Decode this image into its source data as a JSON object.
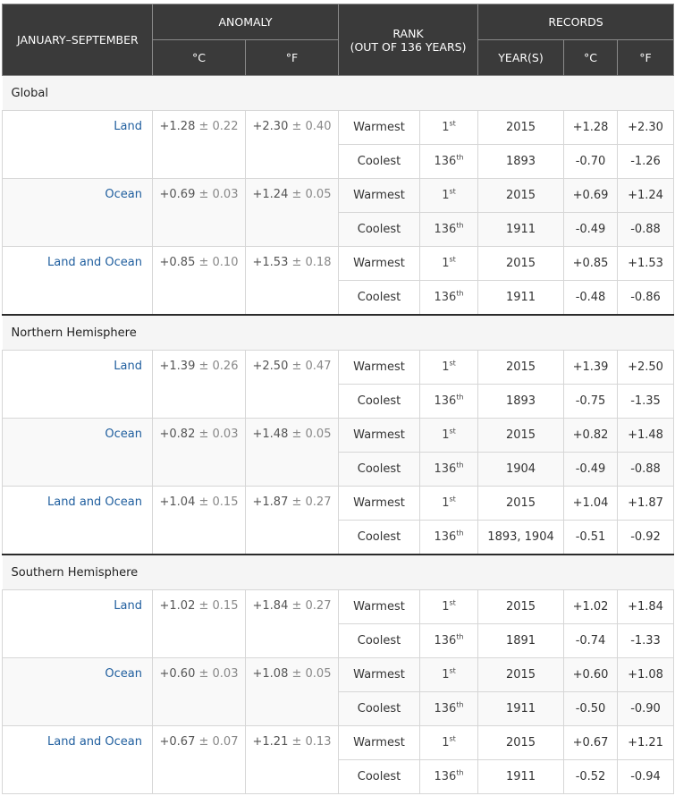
{
  "header": {
    "period": "JANUARY–SEPTEMBER",
    "anomaly": "ANOMALY",
    "rank_title": "RANK",
    "rank_sub": "(OUT OF 136 YEARS)",
    "records": "RECORDS",
    "unit_c": "°C",
    "unit_f": "°F",
    "years": "YEAR(S)"
  },
  "pm": "±",
  "labels": {
    "warmest": "Warmest",
    "coolest": "Coolest"
  },
  "regions": [
    {
      "name": "Global",
      "rows": [
        {
          "name": "Land",
          "anom_c": "+1.28",
          "unc_c": "0.22",
          "anom_f": "+2.30",
          "unc_f": "0.40",
          "warm": {
            "rank": "1",
            "suffix": "st",
            "year": "2015",
            "c": "+1.28",
            "f": "+2.30"
          },
          "cool": {
            "rank": "136",
            "suffix": "th",
            "year": "1893",
            "c": "-0.70",
            "f": "-1.26"
          }
        },
        {
          "name": "Ocean",
          "anom_c": "+0.69",
          "unc_c": "0.03",
          "anom_f": "+1.24",
          "unc_f": "0.05",
          "warm": {
            "rank": "1",
            "suffix": "st",
            "year": "2015",
            "c": "+0.69",
            "f": "+1.24"
          },
          "cool": {
            "rank": "136",
            "suffix": "th",
            "year": "1911",
            "c": "-0.49",
            "f": "-0.88"
          }
        },
        {
          "name": "Land and Ocean",
          "anom_c": "+0.85",
          "unc_c": "0.10",
          "anom_f": "+1.53",
          "unc_f": "0.18",
          "warm": {
            "rank": "1",
            "suffix": "st",
            "year": "2015",
            "c": "+0.85",
            "f": "+1.53"
          },
          "cool": {
            "rank": "136",
            "suffix": "th",
            "year": "1911",
            "c": "-0.48",
            "f": "-0.86"
          }
        }
      ]
    },
    {
      "name": "Northern Hemisphere",
      "rows": [
        {
          "name": "Land",
          "anom_c": "+1.39",
          "unc_c": "0.26",
          "anom_f": "+2.50",
          "unc_f": "0.47",
          "warm": {
            "rank": "1",
            "suffix": "st",
            "year": "2015",
            "c": "+1.39",
            "f": "+2.50"
          },
          "cool": {
            "rank": "136",
            "suffix": "th",
            "year": "1893",
            "c": "-0.75",
            "f": "-1.35"
          }
        },
        {
          "name": "Ocean",
          "anom_c": "+0.82",
          "unc_c": "0.03",
          "anom_f": "+1.48",
          "unc_f": "0.05",
          "warm": {
            "rank": "1",
            "suffix": "st",
            "year": "2015",
            "c": "+0.82",
            "f": "+1.48"
          },
          "cool": {
            "rank": "136",
            "suffix": "th",
            "year": "1904",
            "c": "-0.49",
            "f": "-0.88"
          }
        },
        {
          "name": "Land and Ocean",
          "anom_c": "+1.04",
          "unc_c": "0.15",
          "anom_f": "+1.87",
          "unc_f": "0.27",
          "warm": {
            "rank": "1",
            "suffix": "st",
            "year": "2015",
            "c": "+1.04",
            "f": "+1.87"
          },
          "cool": {
            "rank": "136",
            "suffix": "th",
            "year": "1893, 1904",
            "c": "-0.51",
            "f": "-0.92"
          }
        }
      ]
    },
    {
      "name": "Southern Hemisphere",
      "rows": [
        {
          "name": "Land",
          "anom_c": "+1.02",
          "unc_c": "0.15",
          "anom_f": "+1.84",
          "unc_f": "0.27",
          "warm": {
            "rank": "1",
            "suffix": "st",
            "year": "2015",
            "c": "+1.02",
            "f": "+1.84"
          },
          "cool": {
            "rank": "136",
            "suffix": "th",
            "year": "1891",
            "c": "-0.74",
            "f": "-1.33"
          }
        },
        {
          "name": "Ocean",
          "anom_c": "+0.60",
          "unc_c": "0.03",
          "anom_f": "+1.08",
          "unc_f": "0.05",
          "warm": {
            "rank": "1",
            "suffix": "st",
            "year": "2015",
            "c": "+0.60",
            "f": "+1.08"
          },
          "cool": {
            "rank": "136",
            "suffix": "th",
            "year": "1911",
            "c": "-0.50",
            "f": "-0.90"
          }
        },
        {
          "name": "Land and Ocean",
          "anom_c": "+0.67",
          "unc_c": "0.07",
          "anom_f": "+1.21",
          "unc_f": "0.13",
          "warm": {
            "rank": "1",
            "suffix": "st",
            "year": "2015",
            "c": "+0.67",
            "f": "+1.21"
          },
          "cool": {
            "rank": "136",
            "suffix": "th",
            "year": "1911",
            "c": "-0.52",
            "f": "-0.94"
          }
        }
      ]
    }
  ]
}
